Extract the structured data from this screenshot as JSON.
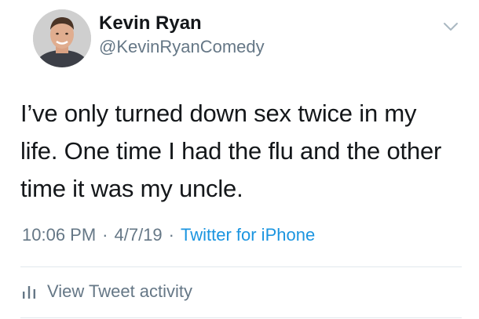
{
  "tweet": {
    "author_name": "Kevin Ryan",
    "author_handle": "@KevinRyanComedy",
    "text_lines": [
      "I’ve only turned down sex twice in my",
      "life. One time I had the flu and the other",
      "time it was my uncle."
    ],
    "time": "10:06 PM",
    "date": "4/7/19",
    "separator": "·",
    "source": "Twitter for iPhone",
    "source_color": "#1b95e0"
  },
  "activity": {
    "label": "View Tweet activity",
    "icon": "bar-chart-icon"
  },
  "menu": {
    "icon": "chevron-down-icon"
  },
  "avatar": {
    "icon": "profile-photo"
  }
}
